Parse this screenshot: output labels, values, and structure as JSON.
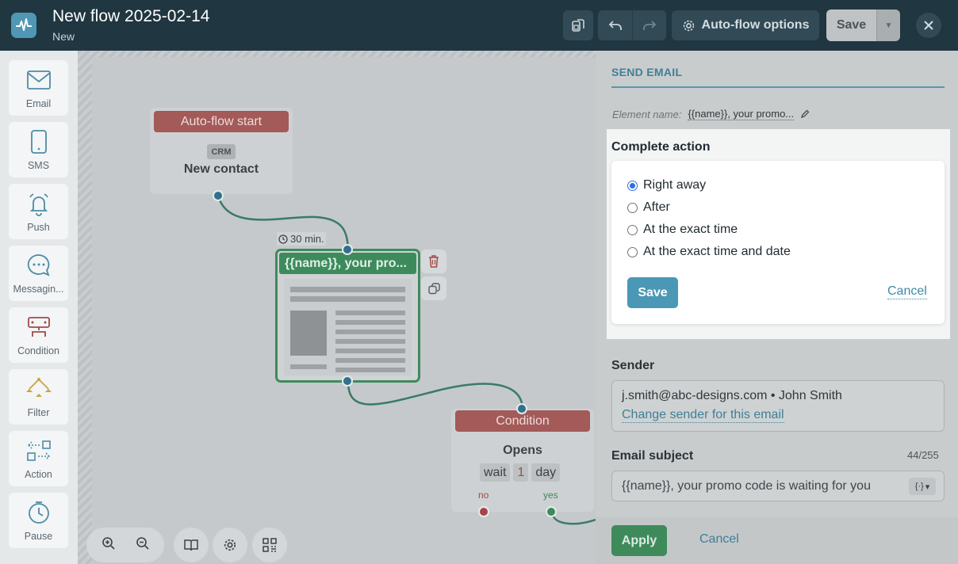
{
  "header": {
    "title": "New flow 2025-02-14",
    "status": "New",
    "auto_flow_options_label": "Auto-flow options",
    "save_label": "Save"
  },
  "palette": {
    "items": [
      {
        "label": "Email",
        "icon": "envelope-icon"
      },
      {
        "label": "SMS",
        "icon": "phone-icon"
      },
      {
        "label": "Push",
        "icon": "bell-icon"
      },
      {
        "label": "Messagin...",
        "icon": "chat-bubble-icon"
      },
      {
        "label": "Condition",
        "icon": "condition-icon"
      },
      {
        "label": "Filter",
        "icon": "filter-icon"
      },
      {
        "label": "Action",
        "icon": "action-icon"
      },
      {
        "label": "Pause",
        "icon": "clock-icon"
      }
    ]
  },
  "canvas": {
    "start_node": {
      "header": "Auto-flow start",
      "tag": "CRM",
      "label": "New contact"
    },
    "delay_label": "30 min.",
    "email_node": {
      "header": "{{name}}, your pro..."
    },
    "condition_node": {
      "header": "Condition",
      "label": "Opens",
      "wait_word": "wait",
      "wait_num": "1",
      "wait_unit": "day",
      "branch_no": "no",
      "branch_yes": "yes"
    }
  },
  "panel": {
    "section_title": "SEND EMAIL",
    "element_name_label": "Element name:",
    "element_name_value": "{{name}}, your promo...",
    "complete_action": {
      "title": "Complete action",
      "options": [
        "Right away",
        "After",
        "At the exact time",
        "At the exact time and date"
      ],
      "selected_index": 0,
      "save_label": "Save",
      "cancel_label": "Cancel"
    },
    "sender": {
      "label": "Sender",
      "value": "j.smith@abc-designs.com • John Smith",
      "change_link": "Change sender for this email"
    },
    "subject": {
      "label": "Email subject",
      "counter": "44/255",
      "value": "{{name}}, your promo code is waiting for you"
    },
    "footer": {
      "apply_label": "Apply",
      "cancel_label": "Cancel"
    }
  },
  "colors": {
    "topbar": "#203640",
    "accent_blue": "#4a97b6",
    "accent_green": "#3e8a5b",
    "node_red": "#a35a58",
    "radio_selected": "#2f6fde"
  }
}
